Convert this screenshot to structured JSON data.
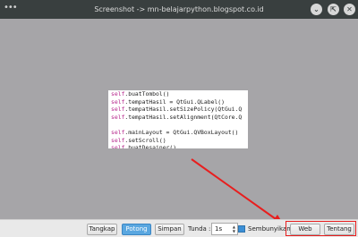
{
  "window": {
    "title": "Screenshot -> mn-belajarpython.blogspot.co.id",
    "menu_icon": "menu-dots-icon",
    "controls": [
      "minimize-icon",
      "maximize-icon",
      "close-icon"
    ]
  },
  "code_lines": [
    {
      "obj": "self",
      "rest": ".buatTombol()"
    },
    {
      "obj": "self",
      "rest": ".tempatHasil = QtGui.QLabel()"
    },
    {
      "obj": "self",
      "rest": ".tempatHasil.setSizePolicy(QtGui.Q"
    },
    {
      "obj": "self",
      "rest": ".tempatHasil.setAlignment(QtCore.Q"
    },
    {
      "obj": "",
      "rest": ""
    },
    {
      "obj": "self",
      "rest": ".mainLayout = QtGui.QVBoxLayout()"
    },
    {
      "obj": "self",
      "rest": ".setScroll()"
    },
    {
      "obj": "self",
      "rest": ".buatDesainer()"
    }
  ],
  "toolbar": {
    "capture_label": "Tangkap",
    "crop_label": "Potong",
    "save_label": "Simpan",
    "delay_label": "Tunda :",
    "delay_value": "1s",
    "hide_label": "Sembunyikan",
    "hide_checked": true,
    "web_label": "Web",
    "about_label": "Tentang"
  },
  "colors": {
    "annotation": "#e81e1e",
    "active_button": "#5aa7e0",
    "titlebar": "#393f3f"
  }
}
